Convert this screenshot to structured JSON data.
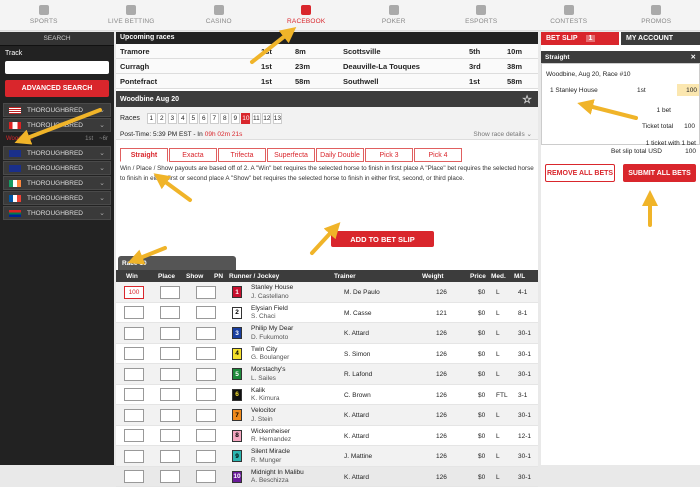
{
  "topnav": [
    {
      "label": "SPORTS",
      "icon": "sports-icon",
      "active": false
    },
    {
      "label": "LIVE BETTING",
      "icon": "live-betting-icon",
      "active": false
    },
    {
      "label": "CASINO",
      "icon": "casino-icon",
      "active": false
    },
    {
      "label": "RACEBOOK",
      "icon": "racebook-icon",
      "active": true
    },
    {
      "label": "POKER",
      "icon": "poker-icon",
      "active": false
    },
    {
      "label": "ESPORTS",
      "icon": "esports-icon",
      "active": false
    },
    {
      "label": "CONTESTS",
      "icon": "contests-icon",
      "active": false
    },
    {
      "label": "PROMOS",
      "icon": "promos-icon",
      "active": false
    }
  ],
  "sidebar": {
    "search_label": "SEARCH",
    "track_label": "Track",
    "advanced_search": "ADVANCED SEARCH",
    "groups": [
      {
        "flag": "usa",
        "label": "THOROUGHBRED"
      },
      {
        "flag": "canada",
        "label": "THOROUGHBRED"
      },
      {
        "flag": "australia",
        "label": "THOROUGHBRED"
      },
      {
        "flag": "uk",
        "label": "THOROUGHBRED"
      },
      {
        "flag": "ireland",
        "label": "THOROUGHBRED"
      },
      {
        "flag": "france",
        "label": "THOROUGHBRED"
      },
      {
        "flag": "south-africa",
        "label": "THOROUGHBRED"
      }
    ],
    "sub_item": {
      "track": "Woodbine",
      "r1": "1st",
      "r2": "~6r"
    }
  },
  "upcoming": {
    "title": "Upcoming races",
    "rows": [
      {
        "t1": "Tramore",
        "p1": "1st",
        "m1": "8m",
        "t2": "Scottsville",
        "p2": "5th",
        "m2": "10m"
      },
      {
        "t1": "Curragh",
        "p1": "1st",
        "m1": "23m",
        "t2": "Deauville-La Touques",
        "p2": "3rd",
        "m2": "38m"
      },
      {
        "t1": "Pontefract",
        "p1": "1st",
        "m1": "58m",
        "t2": "Southwell",
        "p2": "1st",
        "m2": "58m"
      }
    ]
  },
  "race_header": {
    "track": "Woodbine",
    "date": "Aug 20",
    "races_label": "Races",
    "races": [
      "1",
      "2",
      "3",
      "4",
      "5",
      "6",
      "7",
      "8",
      "9",
      "10",
      "11",
      "12",
      "13"
    ],
    "selected": "10",
    "post_time": "Post-Time: 5:39 PM EST - In",
    "countdown": "09h 02m 21s",
    "show_details": "Show race details"
  },
  "bet_types": [
    "Straight",
    "Exacta",
    "Trifecta",
    "Superfecta",
    "Daily Double",
    "Pick 3",
    "Pick 4"
  ],
  "bet_type_selected": "Straight",
  "description": "Win / Place / Show payouts are based off of 2. A \"Win\" bet requires the selected horse to finish in first place A \"Place\" bet requires the selected horse to finish in either first or second place A \"Show\" bet requires the selected horse to finish in either first, second, or third place.",
  "add_to_slip": "ADD TO BET SLIP",
  "race_tab": "Race 10",
  "columns": {
    "win": "Win",
    "place": "Place",
    "show": "Show",
    "pn": "PN",
    "runner": "Runner / Jockey",
    "trainer": "Trainer",
    "weight": "Weight",
    "price": "Price",
    "med": "Med.",
    "ml": "M/L"
  },
  "runners": [
    {
      "pn": "1",
      "color": "#c8102e",
      "text": "#fff",
      "name": "Stanley House",
      "jockey": "J. Castellano",
      "trainer": "M. De Paulo",
      "weight": "126",
      "price": "$0",
      "med": "L",
      "ml": "4-1",
      "win": "100"
    },
    {
      "pn": "2",
      "color": "#ffffff",
      "text": "#000",
      "name": "Elysian Field",
      "jockey": "S. Chaci",
      "trainer": "M. Casse",
      "weight": "121",
      "price": "$0",
      "med": "L",
      "ml": "8-1",
      "win": ""
    },
    {
      "pn": "3",
      "color": "#1a3fa0",
      "text": "#fff",
      "name": "Philip My Dear",
      "jockey": "D. Fukumoto",
      "trainer": "K. Attard",
      "weight": "126",
      "price": "$0",
      "med": "L",
      "ml": "30-1",
      "win": ""
    },
    {
      "pn": "4",
      "color": "#f5e02b",
      "text": "#000",
      "name": "Twin City",
      "jockey": "G. Boulanger",
      "trainer": "S. Simon",
      "weight": "126",
      "price": "$0",
      "med": "L",
      "ml": "30-1",
      "win": ""
    },
    {
      "pn": "5",
      "color": "#1d8a3a",
      "text": "#fff",
      "name": "Morstachy's",
      "jockey": "L. Sailes",
      "trainer": "R. Lafond",
      "weight": "126",
      "price": "$0",
      "med": "L",
      "ml": "30-1",
      "win": ""
    },
    {
      "pn": "6",
      "color": "#111111",
      "text": "#f5e02b",
      "name": "Kalik",
      "jockey": "K. Kimura",
      "trainer": "C. Brown",
      "weight": "126",
      "price": "$0",
      "med": "FTL",
      "ml": "3-1",
      "win": ""
    },
    {
      "pn": "7",
      "color": "#f08a1c",
      "text": "#000",
      "name": "Velocitor",
      "jockey": "J. Stein",
      "trainer": "K. Attard",
      "weight": "126",
      "price": "$0",
      "med": "L",
      "ml": "30-1",
      "win": ""
    },
    {
      "pn": "8",
      "color": "#f4a6c0",
      "text": "#000",
      "name": "Wickenheiser",
      "jockey": "R. Hernandez",
      "trainer": "K. Attard",
      "weight": "126",
      "price": "$0",
      "med": "L",
      "ml": "12-1",
      "win": ""
    },
    {
      "pn": "9",
      "color": "#2bb5b0",
      "text": "#000",
      "name": "Silent Miracle",
      "jockey": "R. Munger",
      "trainer": "J. Mattine",
      "weight": "126",
      "price": "$0",
      "med": "L",
      "ml": "30-1",
      "win": ""
    },
    {
      "pn": "10",
      "color": "#6a1b9a",
      "text": "#fff",
      "name": "Midnight In Malibu",
      "jockey": "A. Beschizza",
      "trainer": "K. Attard",
      "weight": "126",
      "price": "$0",
      "med": "L",
      "ml": "30-1",
      "win": ""
    }
  ],
  "betslip": {
    "tab_label": "BET SLIP",
    "count": "1",
    "account_label": "MY ACCOUNT",
    "section": "Straight",
    "event": "Woodbine, Aug 20, Race #10",
    "horse": "1  Stanley House",
    "position": "1st",
    "amount": "100",
    "one_bet": "1 bet",
    "ticket_total_label": "Ticket total",
    "ticket_total": "100",
    "tickets_line": "1 ticket with 1 bet",
    "slip_total_label": "Bet slip total USD",
    "slip_total": "100",
    "remove": "REMOVE ALL BETS",
    "submit": "SUBMIT ALL BETS"
  }
}
